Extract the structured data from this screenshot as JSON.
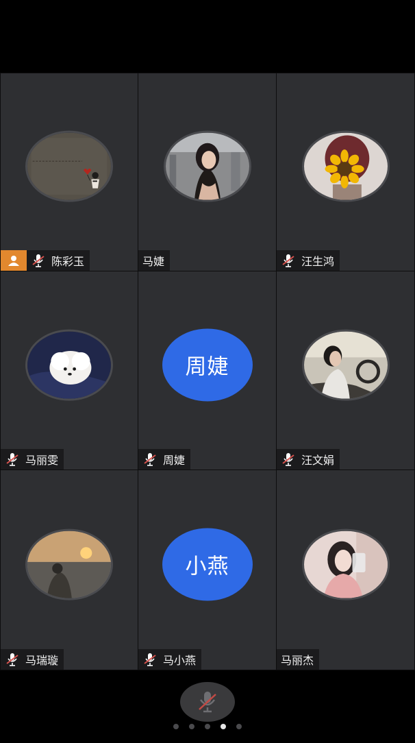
{
  "participants": [
    {
      "name": "陈彩玉",
      "avatar_type": "photo",
      "avatar_icon": "sketch-doodle",
      "mic_muted": true,
      "is_host": true
    },
    {
      "name": "马婕",
      "avatar_type": "photo",
      "avatar_icon": "woman-portrait",
      "mic_muted": false,
      "is_host": false
    },
    {
      "name": "汪生鸿",
      "avatar_type": "photo",
      "avatar_icon": "sunflower-portrait",
      "mic_muted": true,
      "is_host": false
    },
    {
      "name": "马丽雯",
      "avatar_type": "photo",
      "avatar_icon": "white-puppy",
      "mic_muted": true,
      "is_host": false
    },
    {
      "name": "周婕",
      "avatar_type": "initials",
      "avatar_text": "周婕",
      "mic_muted": true,
      "is_host": false
    },
    {
      "name": "汪文娟",
      "avatar_type": "photo",
      "avatar_icon": "woman-driving",
      "mic_muted": true,
      "is_host": false
    },
    {
      "name": "马瑞璇",
      "avatar_type": "photo",
      "avatar_icon": "sunset-beach",
      "mic_muted": true,
      "is_host": false
    },
    {
      "name": "马小燕",
      "avatar_type": "initials",
      "avatar_text": "小燕",
      "mic_muted": true,
      "is_host": false
    },
    {
      "name": "马丽杰",
      "avatar_type": "photo",
      "avatar_icon": "woman-portrait-pink",
      "mic_muted": false,
      "is_host": false
    }
  ],
  "bottom_bar": {
    "mute_button_icon": "mic-muted-icon",
    "page_count": 5,
    "active_page": 4
  },
  "colors": {
    "tile_bg": "#2e2f32",
    "initials_avatar": "#2f6ae6",
    "host_badge": "#e2882e",
    "muted_mic_slash": "#d9534f"
  }
}
